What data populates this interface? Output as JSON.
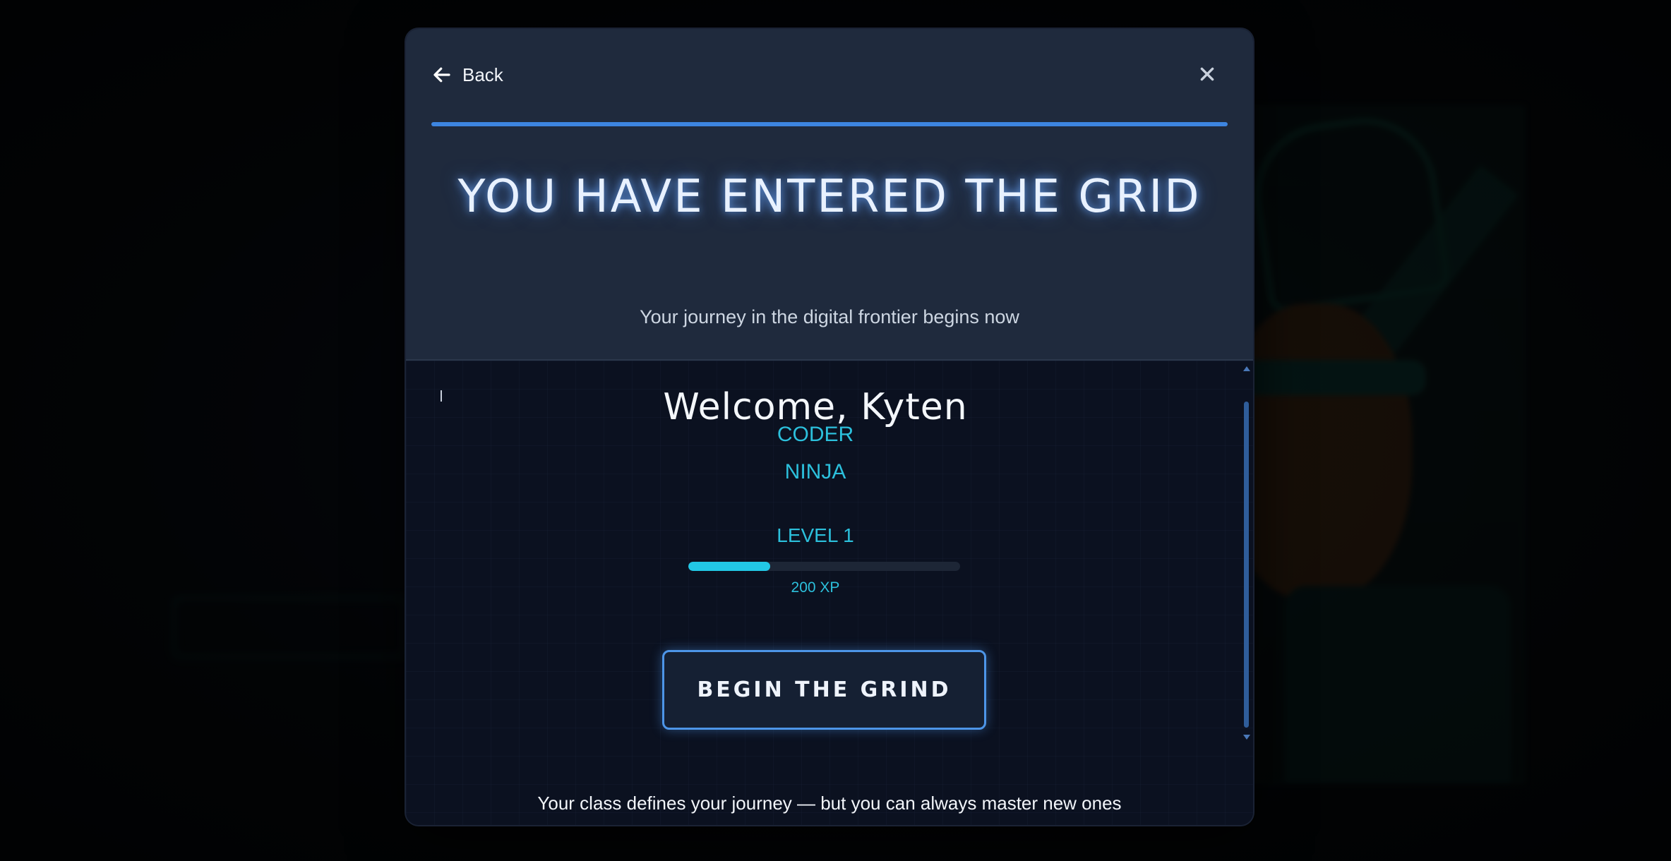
{
  "modal": {
    "back_label": "Back",
    "close_icon": "close-icon",
    "back_icon": "arrow-left-icon",
    "title": "YOU HAVE ENTERED THE GRID",
    "subtitle": "Your journey in the digital frontier begins now"
  },
  "profile": {
    "welcome": "Welcome, Kyten",
    "class_line_1": "CODER",
    "class_line_2": "NINJA",
    "level": "LEVEL 1",
    "xp": "200 XP",
    "xp_progress_fraction": 0.3
  },
  "actions": {
    "begin_label": "BEGIN THE GRIND"
  },
  "footer": {
    "note": "Your class defines your journey — but you can always master new ones"
  },
  "colors": {
    "accent_blue": "#3d85e0",
    "accent_cyan": "#2cc0dc",
    "modal_header_bg": "#1f2a3d",
    "modal_body_bg": "#0b1120"
  }
}
